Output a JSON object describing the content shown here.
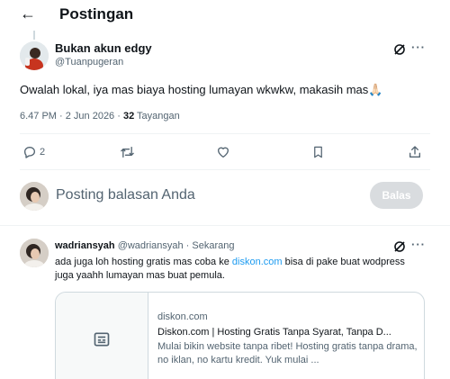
{
  "header": {
    "back_icon": "arrow-left-icon",
    "title": "Postingan"
  },
  "post": {
    "author_name": "Bukan akun edgy",
    "author_handle": "@Tuanpugeran",
    "text": "Owalah lokal, iya mas biaya hosting lumayan wkwkw, makasih mas",
    "emoji": "🙏🏻",
    "time": "6.47 PM · 2 Jun 2026 · ",
    "views_count": "32",
    "views_label": " Tayangan",
    "reply_count": "2"
  },
  "compose": {
    "placeholder": "Posting balasan Anda",
    "button_label": "Balas"
  },
  "reply": {
    "name": "wadriansyah",
    "handle_time": " @wadriansyah · Sekarang",
    "text_before": "ada juga loh hosting gratis mas coba ke ",
    "link_text": "diskon.com",
    "text_after": " bisa di pake buat wodpress juga yaahh lumayan mas buat pemula.",
    "card": {
      "domain": "diskon.com",
      "title": "Diskon.com | Hosting Gratis Tanpa Syarat, Tanpa D...",
      "description": "Mulai bikin website tanpa ribet! Hosting gratis tanpa drama, no iklan, no kartu kredit. Yuk mulai ..."
    }
  },
  "colors": {
    "accent": "#1d9bf0",
    "muted": "#536471",
    "text": "#0f1419",
    "border": "#cfd9de",
    "disabled_button": "#d9dcdf"
  },
  "icons": [
    "arrow-left-icon",
    "grok-icon",
    "more-icon",
    "reply-icon",
    "retweet-icon",
    "like-icon",
    "bookmark-icon",
    "share-icon",
    "article-icon"
  ]
}
